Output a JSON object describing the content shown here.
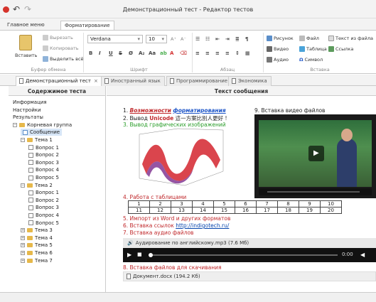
{
  "window": {
    "title": "Демонстрационный тест - Редактор тестов"
  },
  "ribbon_tabs": [
    "Главное меню",
    "Форматирование"
  ],
  "ribbon": {
    "clipboard": {
      "paste": "Вставить",
      "cut": "Вырезать",
      "copy": "Копировать",
      "select_all": "Выделить всё",
      "label": "Буфер обмена"
    },
    "font": {
      "family": "Verdana",
      "size": "10",
      "label": "Шрифт"
    },
    "paragraph": {
      "label": "Абзац"
    },
    "insert": {
      "picture": "Рисунок",
      "file": "Файл",
      "text_from_file": "Текст из файла",
      "video": "Видео",
      "table": "Таблица",
      "link": "Ссылка",
      "audio": "Аудио",
      "symbol": "Символ",
      "label": "Вставка"
    }
  },
  "doc_tabs": [
    "Демонстрационный тест",
    "Иностранный язык",
    "Программирование",
    "Экономика"
  ],
  "left_pane": {
    "title": "Содержимое теста"
  },
  "tree": [
    {
      "label": "Информация",
      "level": 0
    },
    {
      "label": "Настройки",
      "level": 0
    },
    {
      "label": "Результаты",
      "level": 0
    },
    {
      "label": "Корневая группа",
      "level": 0,
      "folder": true
    },
    {
      "label": "Сообщение",
      "level": 1,
      "selected": true
    },
    {
      "label": "Тема 1",
      "level": 1,
      "folder": true
    },
    {
      "label": "Вопрос 1",
      "level": 2
    },
    {
      "label": "Вопрос 2",
      "level": 2
    },
    {
      "label": "Вопрос 3",
      "level": 2
    },
    {
      "label": "Вопрос 4",
      "level": 2
    },
    {
      "label": "Вопрос 5",
      "level": 2
    },
    {
      "label": "Тема 2",
      "level": 1,
      "folder": true
    },
    {
      "label": "Вопрос 1",
      "level": 2
    },
    {
      "label": "Вопрос 2",
      "level": 2
    },
    {
      "label": "Вопрос 3",
      "level": 2
    },
    {
      "label": "Вопрос 4",
      "level": 2
    },
    {
      "label": "Вопрос 5",
      "level": 2
    },
    {
      "label": "Тема 3",
      "level": 1,
      "folder": true
    },
    {
      "label": "Тема 4",
      "level": 1,
      "folder": true
    },
    {
      "label": "Тема 5",
      "level": 1,
      "folder": true
    },
    {
      "label": "Тема 6",
      "level": 1,
      "folder": true
    },
    {
      "label": "Тема 7",
      "level": 1,
      "folder": true
    }
  ],
  "right_pane": {
    "title": "Текст сообщения"
  },
  "content": {
    "l1_num": "1.",
    "l1_a": "Возможности",
    "l1_b": "форматирования",
    "l2_num": "2. Вывод",
    "l2_uni": "Unicode",
    "l2_rest": "這一方案比別人更好 !",
    "l3": "3. Вывод графических изображений",
    "l4": "4. Работа с таблицами",
    "table": [
      [
        "1",
        "2",
        "3",
        "4",
        "5",
        "6",
        "7",
        "8",
        "9",
        "10"
      ],
      [
        "11",
        "12",
        "13",
        "14",
        "15",
        "16",
        "17",
        "18",
        "19",
        "20"
      ]
    ],
    "l5": "5. Импорт из Word и других форматов",
    "l6_a": "6. Вставка ссылок",
    "l6_link": "http://indigotech.ru/",
    "l7": "7. Вставка аудио файлов",
    "audio_file": "Аудирование по английскому.mp3 (7.6 Мб)",
    "audio_time": "0:00",
    "l8": "8. Вставка файлов для скачивания",
    "attach": "Документ.docx (194.2 Кб)",
    "l9": "9. Вставка видео файлов"
  },
  "colors": {
    "accent": "#1e56c8",
    "red": "#c0282b",
    "green": "#2a9d2a",
    "link": "#0645ad"
  }
}
